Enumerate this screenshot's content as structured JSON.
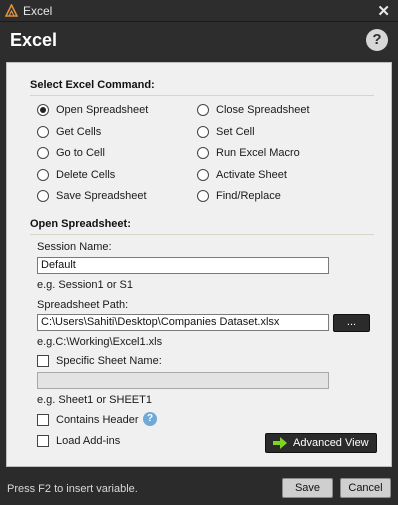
{
  "window": {
    "title": "Excel",
    "close_glyph": "✕"
  },
  "header": {
    "title": "Excel",
    "help_glyph": "?"
  },
  "command_section": {
    "title": "Select Excel Command:",
    "selected": "Open Spreadsheet",
    "options": [
      {
        "label": "Open Spreadsheet",
        "checked": true
      },
      {
        "label": "Close Spreadsheet",
        "checked": false
      },
      {
        "label": "Get Cells",
        "checked": false
      },
      {
        "label": "Set Cell",
        "checked": false
      },
      {
        "label": "Go to Cell",
        "checked": false
      },
      {
        "label": "Run Excel Macro",
        "checked": false
      },
      {
        "label": "Delete Cells",
        "checked": false
      },
      {
        "label": "Activate Sheet",
        "checked": false
      },
      {
        "label": "Save Spreadsheet",
        "checked": false
      },
      {
        "label": "Find/Replace",
        "checked": false
      }
    ]
  },
  "open_section": {
    "title": "Open Spreadsheet:",
    "session_label": "Session Name:",
    "session_value": "Default",
    "session_hint": "e.g. Session1 or S1",
    "path_label": "Spreadsheet Path:",
    "path_value": "C:\\Users\\Sahiti\\Desktop\\Companies Dataset.xlsx",
    "browse_label": "...",
    "path_hint": "e.g.C:\\Working\\Excel1.xls",
    "specific_sheet_label": "Specific Sheet Name:",
    "specific_sheet_checked": false,
    "sheet_value": "",
    "sheet_hint": "e.g. Sheet1 or SHEET1",
    "contains_header_label": "Contains Header",
    "contains_header_checked": false,
    "info_glyph": "?",
    "load_addins_label": "Load Add-ins",
    "load_addins_checked": false,
    "advanced_view_label": "Advanced View"
  },
  "footer": {
    "hint": "Press F2 to insert variable.",
    "save_label": "Save",
    "cancel_label": "Cancel"
  },
  "colors": {
    "chrome": "#2d2d2d",
    "panel": "#f0f0f0",
    "accent_arrow": "#7fd321",
    "info_icon": "#6fa9d6"
  },
  "icons": {
    "app": "excel-app-icon",
    "close": "close-icon",
    "help": "help-icon",
    "info": "info-icon",
    "advanced": "arrow-right-icon"
  }
}
